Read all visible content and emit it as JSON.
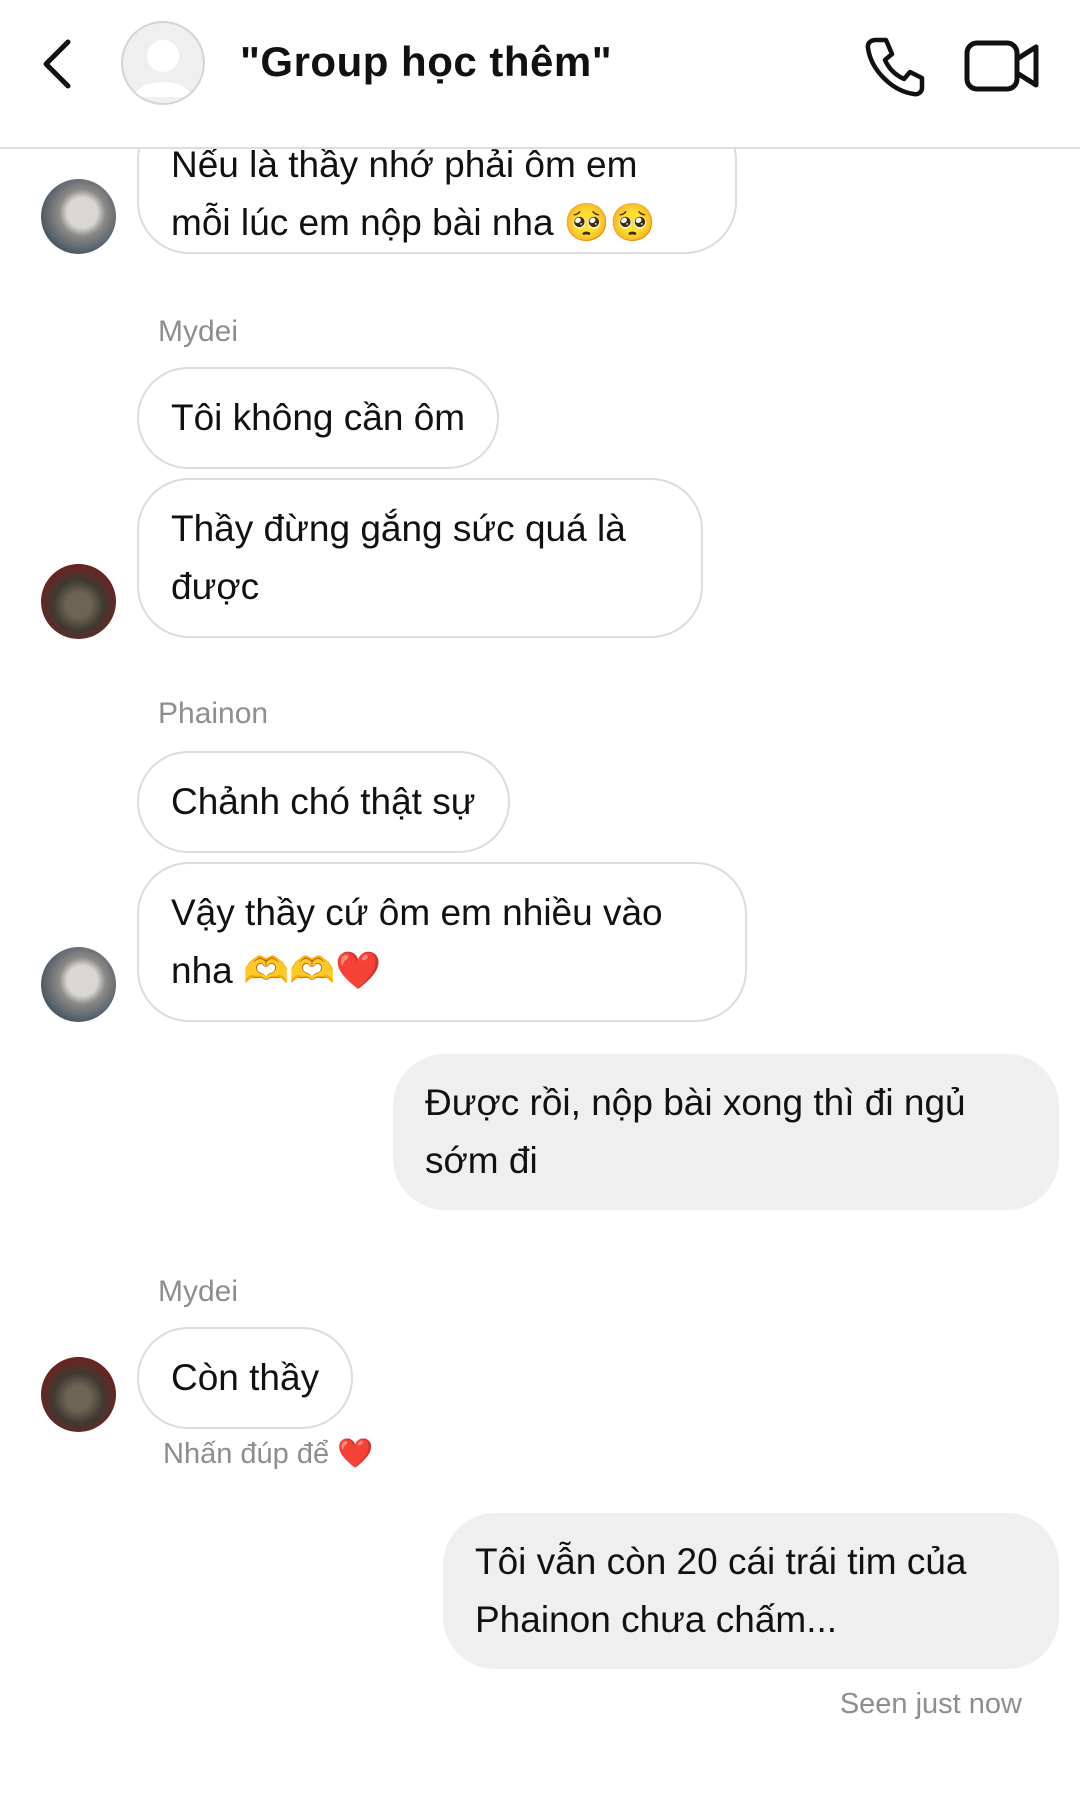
{
  "header": {
    "title": "\"Group học thêm\"",
    "back_icon": "chevron-left-icon",
    "call_icon": "phone-icon",
    "video_icon": "video-camera-icon"
  },
  "messages": [
    {
      "text": "Nếu là thầy nhớ phải ôm em mỗi lúc em nộp bài nha 🥺🥺",
      "direction": "incoming"
    },
    {
      "sender": "Mydei",
      "text": "Tôi không cần ôm",
      "direction": "incoming"
    },
    {
      "text": "Thầy đừng gắng sức quá là được",
      "direction": "incoming"
    },
    {
      "sender": "Phainon",
      "text": "Chảnh chó thật sự",
      "direction": "incoming"
    },
    {
      "text": "Vậy thầy cứ ôm em nhiều vào nha 🫶🫶❤️",
      "direction": "incoming"
    },
    {
      "text": "Được rồi, nộp bài xong thì đi ngủ sớm đi",
      "direction": "outgoing"
    },
    {
      "sender": "Mydei",
      "text": "Còn thầy",
      "direction": "incoming"
    },
    {
      "text": "Tôi vẫn còn 20 cái trái tim của Phainon chưa chấm...",
      "direction": "outgoing"
    }
  ],
  "hint": {
    "text": "Nhấn đúp để",
    "heart": "❤️"
  },
  "status": {
    "seen": "Seen just now"
  },
  "colors": {
    "incoming_border": "#dcdcdc",
    "outgoing_bg": "#efefef",
    "meta_text": "#8e8e8e"
  }
}
